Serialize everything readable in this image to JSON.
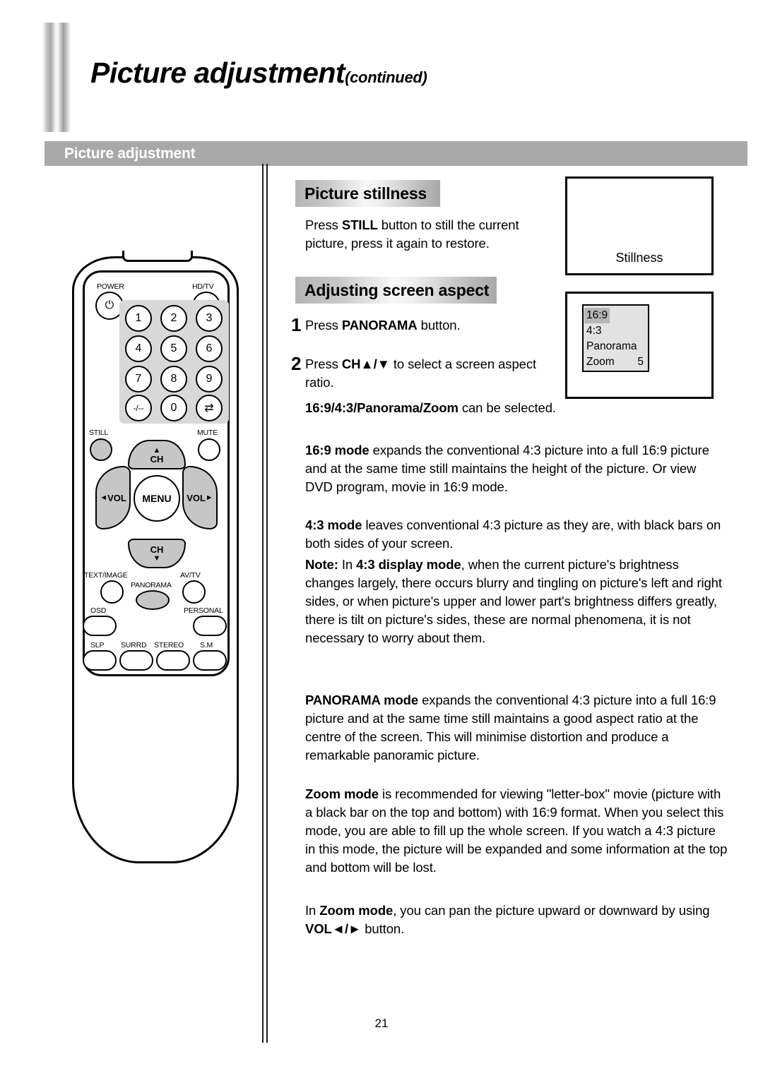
{
  "header": {
    "title_main": "Picture adjustment",
    "title_continued": "(continued)",
    "section_bar_label": "Picture adjustment"
  },
  "sections": {
    "stillness_heading": "Picture stillness",
    "aspect_heading": "Adjusting screen aspect"
  },
  "body": {
    "stillness_para": "Press <b>STILL</b> button to still the current picture, press it again to restore.",
    "step1_number": "1",
    "step1_text": "Press <b>PANORAMA</b> button.",
    "step2_number": "2",
    "step2_text": "Press <b>CH▲/▼</b> to select a screen aspect ratio.",
    "can_be_selected": "<b>16:9/4:3/Panorama/Zoom</b> can be selected.",
    "mode_169": "<b>16:9 mode</b> expands the conventional 4:3 picture into a full 16:9 picture and at the same time still maintains the height of the picture. Or view DVD program, movie in 16:9 mode.",
    "mode_43": "<b>4:3 mode</b> leaves conventional 4:3 picture as they are, with black bars on both sides of your screen.",
    "note_43": "<b>Note:</b> In <b>4:3 display mode</b>, when the current picture's brightness changes largely, there occurs blurry and tingling on picture's left and right sides, or when picture's upper and lower part's brightness differs greatly, there is tilt on picture's sides, these are normal phenomena, it is not necessary to worry about them.",
    "mode_panorama": "<b>PANORAMA mode</b> expands the conventional 4:3 picture into a full 16:9 picture and at the same time still maintains a good aspect ratio at the centre of the screen. This will minimise distortion and produce a remarkable panoramic picture.",
    "mode_zoom": "<b>Zoom mode</b> is recommended for viewing \"letter-box\" movie (picture with a black bar on the top and bottom) with 16:9 format. When you select this mode, you are able to fill up the whole screen. If you watch a 4:3 picture in this mode, the picture will be expanded and some information at the top and bottom will be lost.",
    "zoom_pan": "In <b>Zoom mode</b>, you can pan the picture upward or downward by using <b>VOL◄/►</b> button."
  },
  "illustrations": {
    "stillness_caption": "Stillness",
    "osd_menu": {
      "items": [
        {
          "label": "16:9",
          "value": "",
          "selected": true
        },
        {
          "label": "4:3",
          "value": "",
          "selected": false
        },
        {
          "label": "Panorama",
          "value": "",
          "selected": false
        },
        {
          "label": "Zoom",
          "value": "5",
          "selected": false
        }
      ]
    }
  },
  "remote": {
    "power_label": "POWER",
    "power_glyph": "⏻",
    "hdtv_label": "HD/TV",
    "keypad": [
      "1",
      "2",
      "3",
      "4",
      "5",
      "6",
      "7",
      "8",
      "9",
      "-/--",
      "0",
      "⇄"
    ],
    "still_label": "STILL",
    "mute_label": "MUTE",
    "ch_up_label": "CH",
    "ch_up_arrow": "▲",
    "ch_down_label": "CH",
    "ch_down_arrow": "▼",
    "vol_left_label": "VOL",
    "vol_left_arrow": "◄",
    "vol_right_label": "VOL",
    "vol_right_arrow": "►",
    "menu_label": "MENU",
    "text_image_label": "TEXT/IMAGE",
    "panorama_label": "PANORAMA",
    "avtv_label": "AV/TV",
    "osd_label": "OSD",
    "personal_label": "PERSONAL",
    "slp_label": "SLP",
    "surrd_label": "SURRD",
    "stereo_label": "STEREO",
    "sm_label": "S.M"
  },
  "footer": {
    "page_number": "21"
  },
  "colors": {
    "section_bar": "#a8a8a8",
    "button_grey": "#c6c6c6",
    "keypad_grey": "#d8d8d8",
    "osd_bg": "#e2e2e2",
    "osd_selected": "#b6b6b6"
  }
}
